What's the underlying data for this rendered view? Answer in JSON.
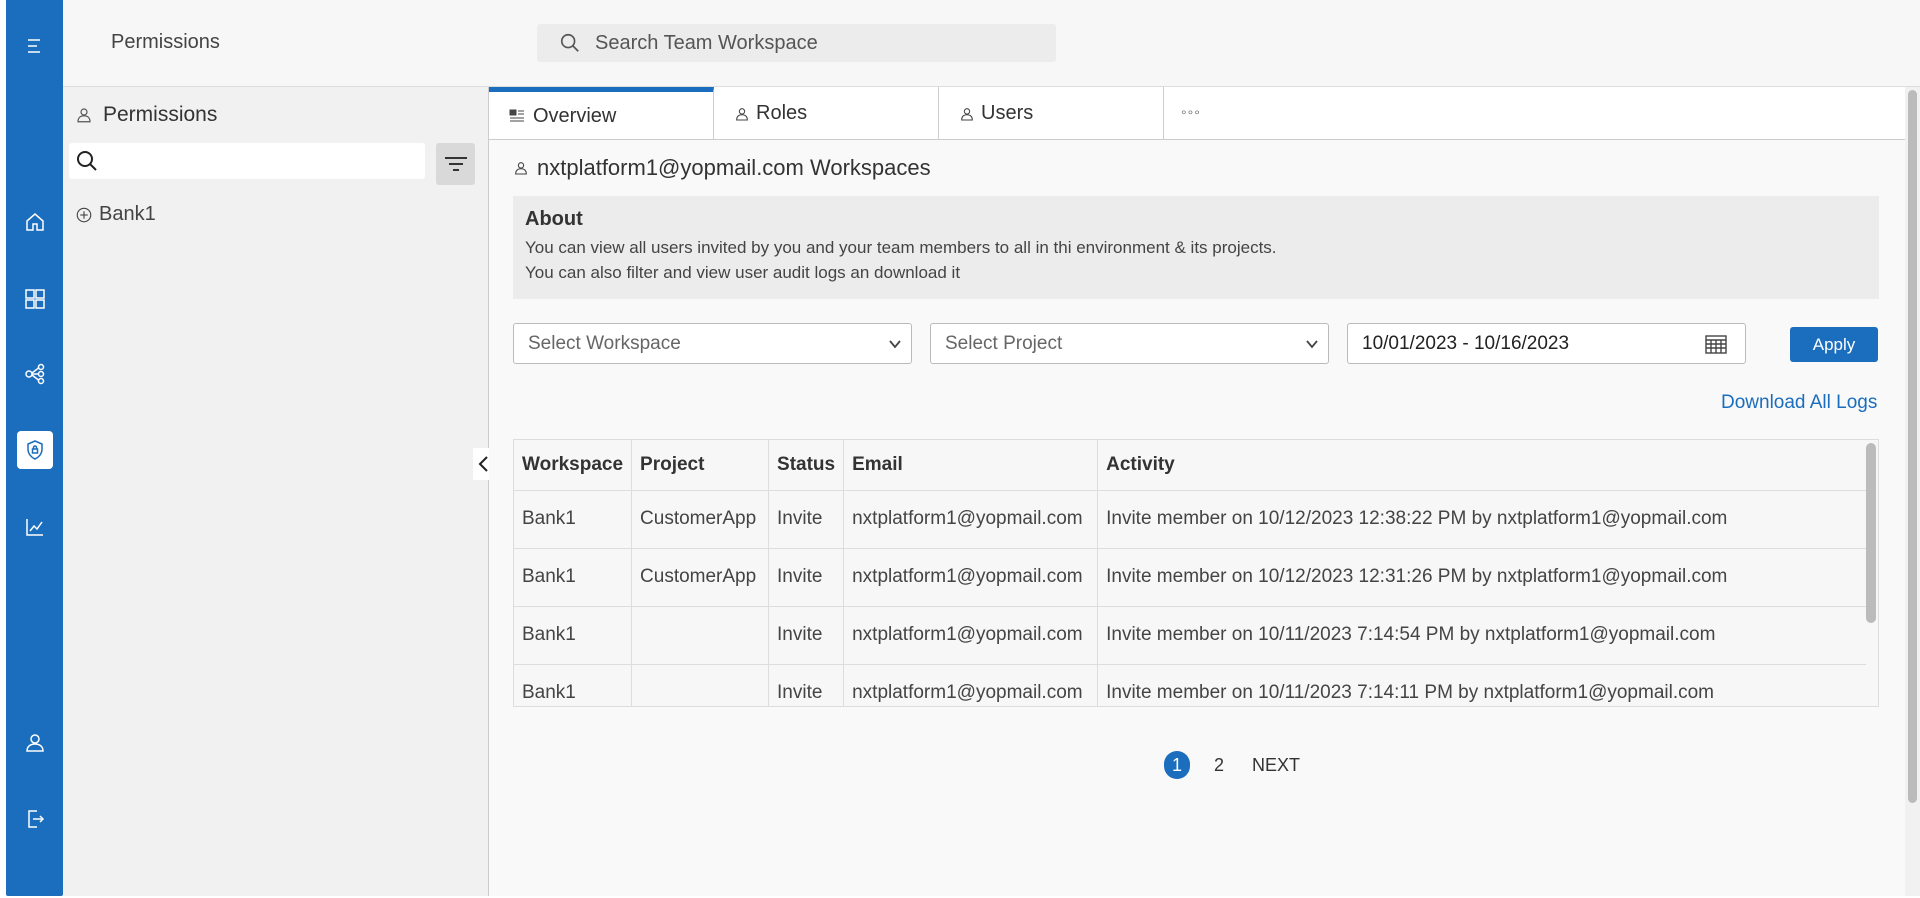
{
  "rail": {
    "icons": [
      "menu-icon",
      "home-icon",
      "dashboard-icon",
      "share-icon",
      "shield-icon",
      "chart-icon",
      "user-icon",
      "logout-icon"
    ],
    "accent": "#1b6dbd"
  },
  "topbar": {
    "breadcrumb": "Permissions",
    "search_placeholder": "Search Team Workspace"
  },
  "left_panel": {
    "title": "Permissions",
    "search_placeholder": "",
    "tree": [
      {
        "label": "Bank1"
      }
    ]
  },
  "tabs": [
    {
      "label": "Overview",
      "active": true
    },
    {
      "label": "Roles",
      "active": false
    },
    {
      "label": "Users",
      "active": false
    }
  ],
  "more_label": "°°°",
  "workspace_title": "nxtplatform1@yopmail.com Workspaces",
  "about": {
    "heading": "About",
    "line1": "You can view all users invited by you and your team members to all in thi environment & its projects.",
    "line2": "You can also filter and view user audit logs an download it"
  },
  "filters": {
    "workspace_placeholder": "Select Workspace",
    "project_placeholder": "Select Project",
    "date_range": "10/01/2023 - 10/16/2023",
    "apply_label": "Apply"
  },
  "download_label": "Download All Logs",
  "table": {
    "headers": [
      "Workspace",
      "Project",
      "Status",
      "Email",
      "Activity"
    ],
    "rows": [
      [
        "Bank1",
        "CustomerApp",
        "Invite",
        "nxtplatform1@yopmail.com",
        "Invite member on 10/12/2023 12:38:22 PM by nxtplatform1@yopmail.com"
      ],
      [
        "Bank1",
        "CustomerApp",
        "Invite",
        "nxtplatform1@yopmail.com",
        "Invite member on 10/12/2023 12:31:26 PM by nxtplatform1@yopmail.com"
      ],
      [
        "Bank1",
        "",
        "Invite",
        "nxtplatform1@yopmail.com",
        "Invite member on 10/11/2023 7:14:54 PM by nxtplatform1@yopmail.com"
      ],
      [
        "Bank1",
        "",
        "Invite",
        "nxtplatform1@yopmail.com",
        "Invite member on 10/11/2023 7:14:11 PM by nxtplatform1@yopmail.com"
      ]
    ]
  },
  "pagination": {
    "pages": [
      "1",
      "2"
    ],
    "current": "1",
    "next_label": "NEXT"
  }
}
